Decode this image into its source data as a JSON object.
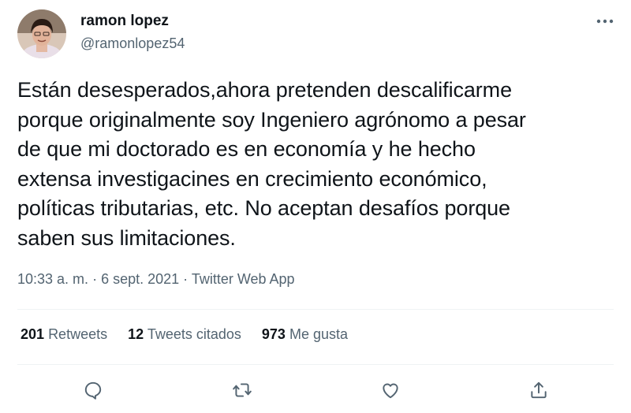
{
  "user": {
    "display_name": "ramon lopez",
    "handle": "@ramonlopez54",
    "avatar_icon": "profile-photo"
  },
  "tweet": {
    "text": "Están desesperados,ahora pretenden descalificarme\nporque originalmente soy Ingeniero agrónomo a pesar\nde que mi doctorado es en economía y he hecho\nextensa investigacines en crecimiento económico,\npolíticas tributarias, etc. No aceptan desafíos porque\nsaben  sus limitaciones."
  },
  "meta": {
    "time": "10:33 a. m.",
    "sep1": " · ",
    "date": "6 sept. 2021",
    "sep2": " · ",
    "source": "Twitter Web App"
  },
  "stats": {
    "retweets_count": "201",
    "retweets_label": "Retweets",
    "quotes_count": "12",
    "quotes_label": "Tweets citados",
    "likes_count": "973",
    "likes_label": "Me gusta"
  },
  "icons": {
    "more": "more-icon",
    "reply": "reply-icon",
    "retweet": "retweet-icon",
    "like": "like-icon",
    "share": "share-icon"
  },
  "colors": {
    "text": "#0f1419",
    "secondary": "#536471",
    "divider": "#eff3f4"
  }
}
